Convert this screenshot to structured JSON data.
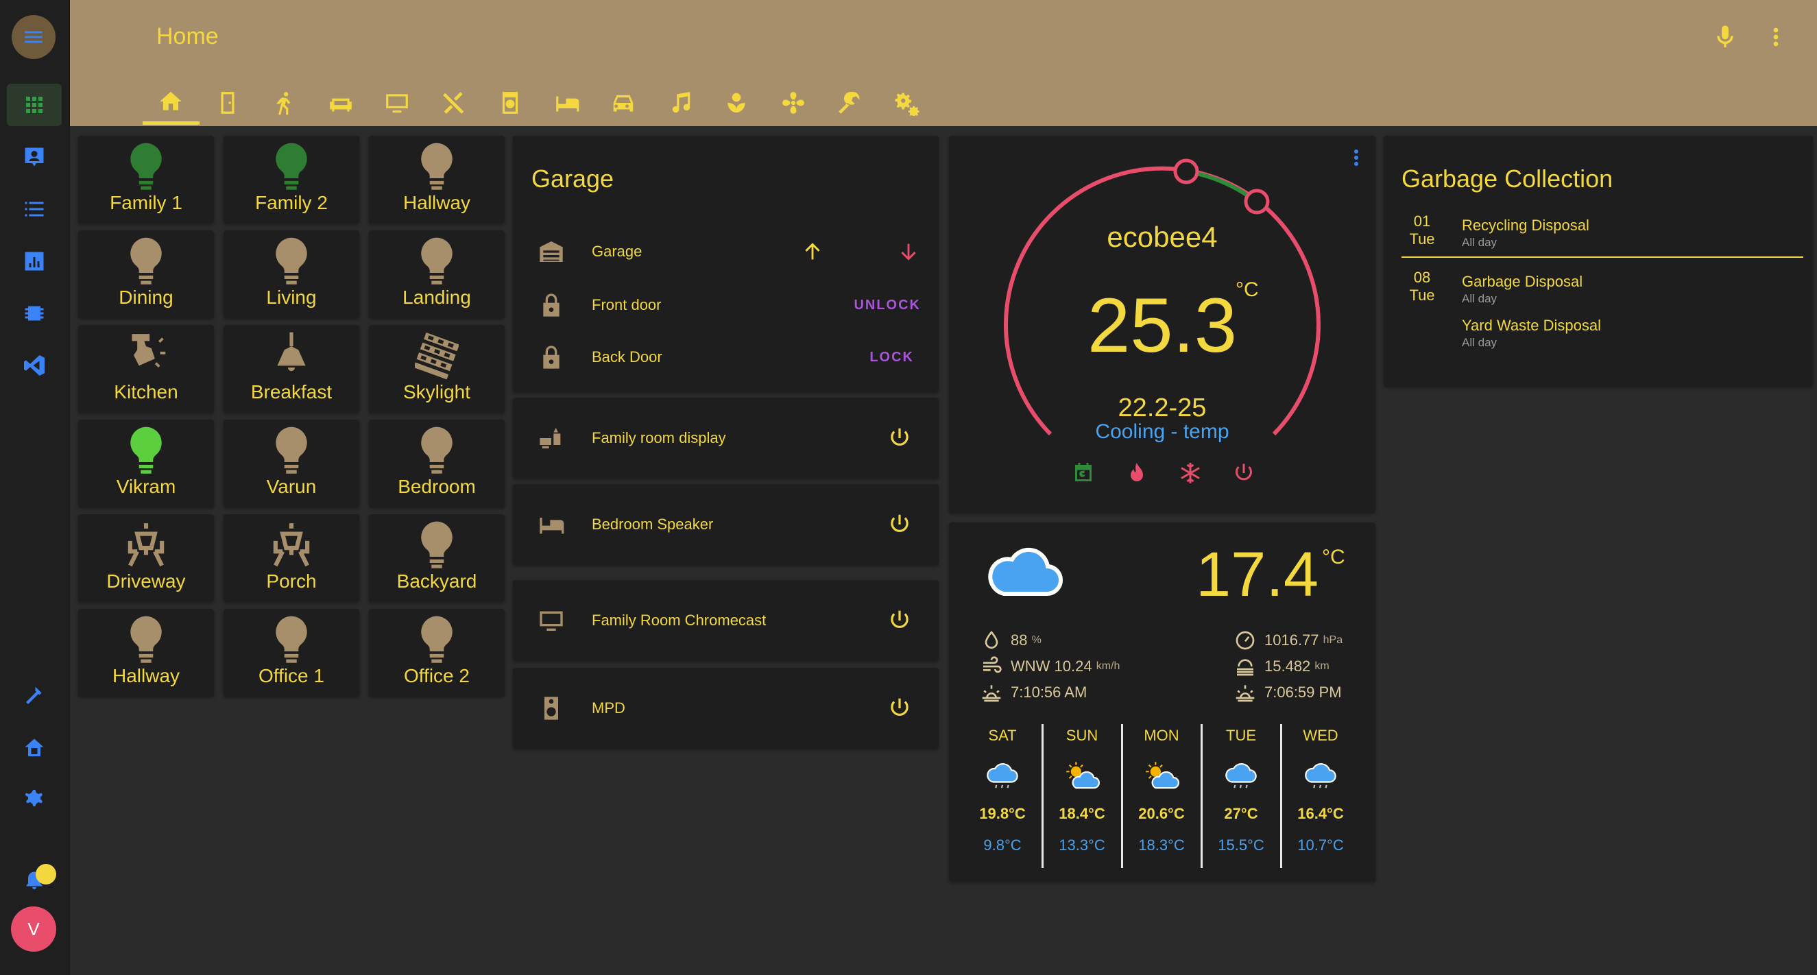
{
  "header": {
    "title": "Home"
  },
  "colors": {
    "accent": "#f3d83f",
    "header_bg": "#a88f6c",
    "card_bg": "#1e1e1e",
    "bulb_on": "#2f7d32",
    "bulb_bright": "#5ccf3e",
    "bulb_off": "#a88f6c",
    "lock_action": "#a855d6",
    "thermo_arc": "#e84e6b",
    "cooling": "#4aa3f0"
  },
  "tabs": [
    "home-icon",
    "door-icon",
    "person-icon",
    "sofa-icon",
    "monitor-icon",
    "utensils-icon",
    "washer-icon",
    "bed-icon",
    "car-icon",
    "music-icon",
    "flower-icon",
    "fan-icon",
    "wrench-icon",
    "gears-icon"
  ],
  "tiles": [
    {
      "label": "Family 1",
      "icon": "bulb",
      "state": "on"
    },
    {
      "label": "Family 2",
      "icon": "bulb",
      "state": "on"
    },
    {
      "label": "Hallway",
      "icon": "bulb",
      "state": "off"
    },
    {
      "label": "Dining",
      "icon": "bulb",
      "state": "off"
    },
    {
      "label": "Living",
      "icon": "bulb",
      "state": "off"
    },
    {
      "label": "Landing",
      "icon": "bulb",
      "state": "off"
    },
    {
      "label": "Kitchen",
      "icon": "spot",
      "state": "off"
    },
    {
      "label": "Breakfast",
      "icon": "pendant",
      "state": "off"
    },
    {
      "label": "Skylight",
      "icon": "blind",
      "state": "off"
    },
    {
      "label": "Vikram",
      "icon": "bulb",
      "state": "bright"
    },
    {
      "label": "Varun",
      "icon": "bulb",
      "state": "off"
    },
    {
      "label": "Bedroom",
      "icon": "bulb",
      "state": "off"
    },
    {
      "label": "Driveway",
      "icon": "lamp",
      "state": "off"
    },
    {
      "label": "Porch",
      "icon": "lamp",
      "state": "off"
    },
    {
      "label": "Backyard",
      "icon": "bulb",
      "state": "off"
    },
    {
      "label": "Hallway",
      "icon": "bulb",
      "state": "off"
    },
    {
      "label": "Office 1",
      "icon": "bulb",
      "state": "off"
    },
    {
      "label": "Office 2",
      "icon": "bulb",
      "state": "off"
    }
  ],
  "garage": {
    "title": "Garage",
    "rows": [
      {
        "label": "Garage",
        "icon": "garage-icon"
      },
      {
        "label": "Front door",
        "icon": "lock-icon",
        "action": "UNLOCK"
      },
      {
        "label": "Back Door",
        "icon": "lock-icon",
        "action": "LOCK"
      }
    ]
  },
  "media": [
    {
      "label": "Family room display",
      "icon": "display-icon"
    },
    {
      "label": "Bedroom Speaker",
      "icon": "bed-icon"
    },
    {
      "label": "Family Room Chromecast",
      "icon": "monitor-icon"
    },
    {
      "label": "MPD",
      "icon": "speaker-icon"
    }
  ],
  "thermostat": {
    "name": "ecobee4",
    "temp": "25.3",
    "unit": "°C",
    "range": "22.2-25",
    "mode": "Cooling - temp"
  },
  "weather": {
    "temp": "17.4",
    "unit": "°C",
    "humidity": "88",
    "humidity_unit": "%",
    "wind": "WNW 10.24",
    "wind_unit": "km/h",
    "sunrise": "7:10:56 AM",
    "pressure": "1016.77",
    "pressure_unit": "hPa",
    "visibility": "15.482",
    "visibility_unit": "km",
    "sunset": "7:06:59 PM",
    "forecast": [
      {
        "day": "SAT",
        "hi": "19.8°C",
        "lo": "9.8°C",
        "icon": "rain-icon"
      },
      {
        "day": "SUN",
        "hi": "18.4°C",
        "lo": "13.3°C",
        "icon": "partly-sunny-icon"
      },
      {
        "day": "MON",
        "hi": "20.6°C",
        "lo": "18.3°C",
        "icon": "partly-sunny-icon"
      },
      {
        "day": "TUE",
        "hi": "27°C",
        "lo": "15.5°C",
        "icon": "rain-icon"
      },
      {
        "day": "WED",
        "hi": "16.4°C",
        "lo": "10.7°C",
        "icon": "rain-icon"
      }
    ]
  },
  "garbage": {
    "title": "Garbage Collection",
    "groups": [
      {
        "date": "01",
        "dow": "Tue",
        "events": [
          {
            "name": "Recycling Disposal",
            "when": "All day"
          }
        ]
      },
      {
        "date": "08",
        "dow": "Tue",
        "events": [
          {
            "name": "Garbage Disposal",
            "when": "All day"
          },
          {
            "name": "Yard Waste Disposal",
            "when": "All day"
          }
        ]
      }
    ]
  },
  "user": {
    "initial": "V"
  }
}
